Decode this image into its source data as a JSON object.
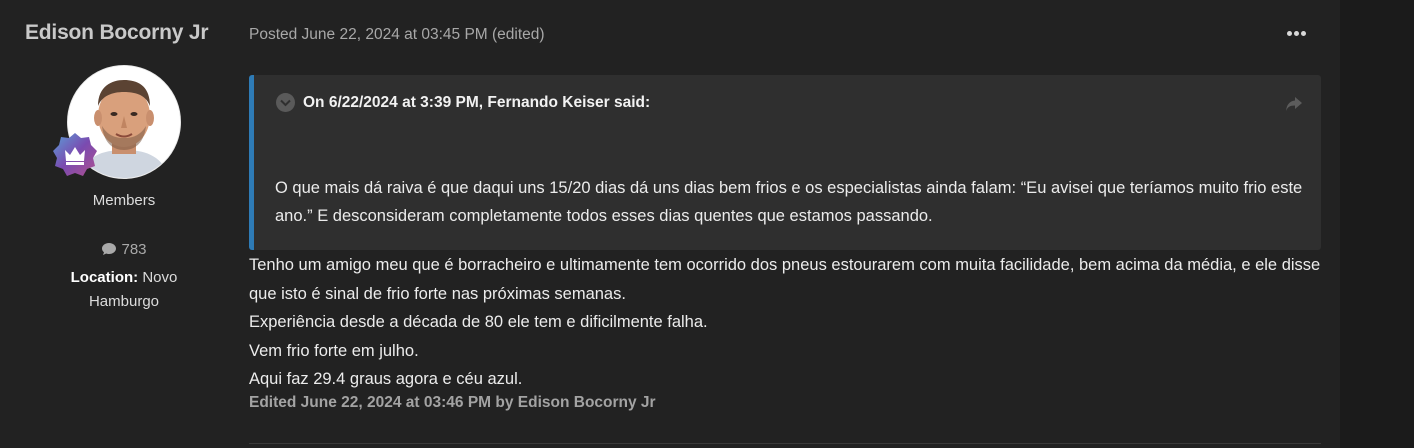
{
  "author": {
    "name": "Edison Bocorny Jr",
    "group": "Members",
    "post_count": "783",
    "location_label": "Location:",
    "location_value": "Novo Hamburgo"
  },
  "post": {
    "posted": "Posted June 22, 2024 at 03:45 PM (edited)",
    "quote": {
      "header": "On 6/22/2024 at 3:39 PM, Fernando Keiser said:",
      "text": "O que mais dá raiva é que daqui uns 15/20 dias dá uns dias bem frios e os especialistas ainda falam: “Eu avisei que teríamos muito frio este ano.” E desconsideram completamente todos esses dias quentes que estamos passando."
    },
    "paragraphs": [
      "Tenho um amigo meu que é borracheiro e ultimamente tem ocorrido dos pneus estourarem com muita facilidade, bem acima da média, e ele disse que isto é sinal de frio forte nas próximas semanas.",
      "Experiência desde a década de 80 ele tem e dificilmente falha.",
      "Vem frio forte em julho.",
      "Aqui faz 29.4 graus agora e céu azul."
    ],
    "edited_note": "Edited June 22, 2024 at 03:46 PM by Edison Bocorny Jr"
  },
  "icons": {
    "more": "ellipsis-icon",
    "toggle": "chevron-down-icon",
    "share": "share-arrow-icon",
    "posts": "comment-icon",
    "badge": "crown-badge-icon"
  },
  "colors": {
    "quote_border": "#2e7bb6",
    "badge": "#7a4bb0"
  }
}
